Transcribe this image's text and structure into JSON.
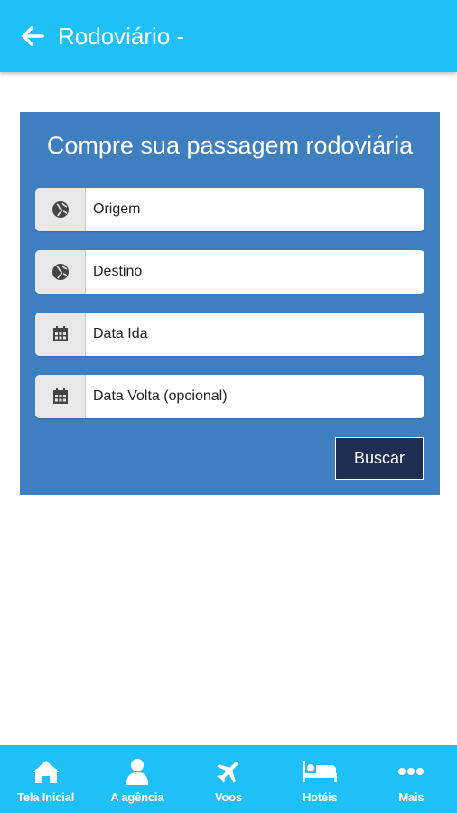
{
  "header": {
    "title": "Rodoviário -",
    "back_icon": "arrow-left-icon"
  },
  "search": {
    "heading": "Compre sua passagem rodoviária",
    "fields": [
      {
        "placeholder": "Origem",
        "icon": "globe-icon"
      },
      {
        "placeholder": "Destino",
        "icon": "globe-icon"
      },
      {
        "placeholder": "Data Ida",
        "icon": "calendar-icon"
      },
      {
        "placeholder": "Data Volta (opcional)",
        "icon": "calendar-icon"
      }
    ],
    "button_label": "Buscar"
  },
  "bottom_nav": {
    "items": [
      {
        "label": "Tela Inicial",
        "icon": "home-icon"
      },
      {
        "label": "A agência",
        "icon": "user-icon"
      },
      {
        "label": "Voos",
        "icon": "plane-icon"
      },
      {
        "label": "Hotéis",
        "icon": "bed-icon"
      },
      {
        "label": "Mais",
        "icon": "more-icon"
      }
    ]
  },
  "colors": {
    "app_bar": "#1ec0f7",
    "card": "#3d7fbf",
    "button": "#1f2d52"
  }
}
